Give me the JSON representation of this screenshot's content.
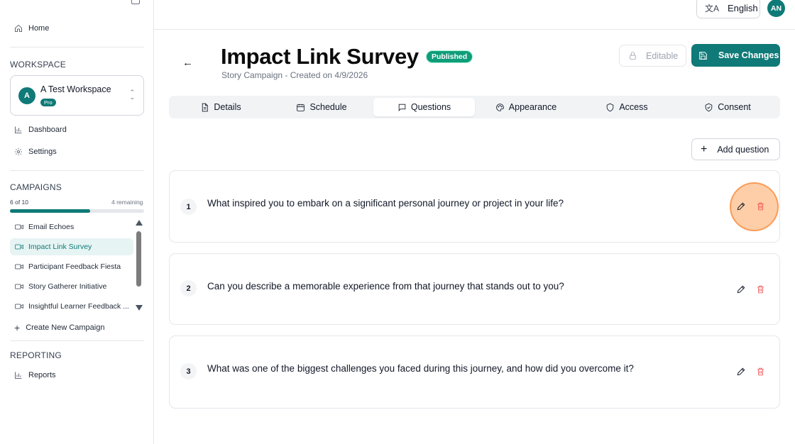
{
  "sidebar": {
    "home_label": "Home",
    "workspace_section": "WORKSPACE",
    "workspace": {
      "initial": "A",
      "name": "A Test Workspace",
      "plan": "Pro"
    },
    "dashboard_label": "Dashboard",
    "settings_label": "Settings",
    "campaigns_section": "CAMPAIGNS",
    "quota": {
      "used_text": "6 of 10",
      "remaining_text": "4 remaining",
      "fraction": 0.6
    },
    "campaigns": [
      {
        "label": "Email Echoes",
        "active": false
      },
      {
        "label": "Impact Link Survey",
        "active": true
      },
      {
        "label": "Participant Feedback Fiesta",
        "active": false
      },
      {
        "label": "Story Gatherer Initiative",
        "active": false
      },
      {
        "label": "Insightful Learner Feedback ...",
        "active": false
      }
    ],
    "create_label": "Create New Campaign",
    "reporting_section": "REPORTING",
    "reports_label": "Reports"
  },
  "topbar": {
    "language_label": "English",
    "language_icon": "translate-icon",
    "user_initials": "AN"
  },
  "header": {
    "title": "Impact Link Survey",
    "status": "Published",
    "subtitle": "Story Campaign - Created on 4/9/2026",
    "editable_label": "Editable",
    "save_label": "Save Changes"
  },
  "tabs": [
    {
      "label": "Details",
      "icon": "document-icon"
    },
    {
      "label": "Schedule",
      "icon": "calendar-icon"
    },
    {
      "label": "Questions",
      "icon": "message-icon"
    },
    {
      "label": "Appearance",
      "icon": "palette-icon"
    },
    {
      "label": "Access",
      "icon": "shield-icon"
    },
    {
      "label": "Consent",
      "icon": "shield-check-icon"
    }
  ],
  "active_tab": "Questions",
  "add_question_label": "Add question",
  "questions": [
    {
      "number": "1",
      "text": "What inspired you to embark on a significant personal journey or project in your life?"
    },
    {
      "number": "2",
      "text": "Can you describe a memorable experience from that journey that stands out to you?"
    },
    {
      "number": "3",
      "text": "What was one of the biggest challenges you faced during this journey, and how did you overcome it?"
    }
  ],
  "colors": {
    "accent": "#0f7a77",
    "published": "#0f9d7a",
    "delete": "#ef4444",
    "highlight": "#fb923c"
  }
}
